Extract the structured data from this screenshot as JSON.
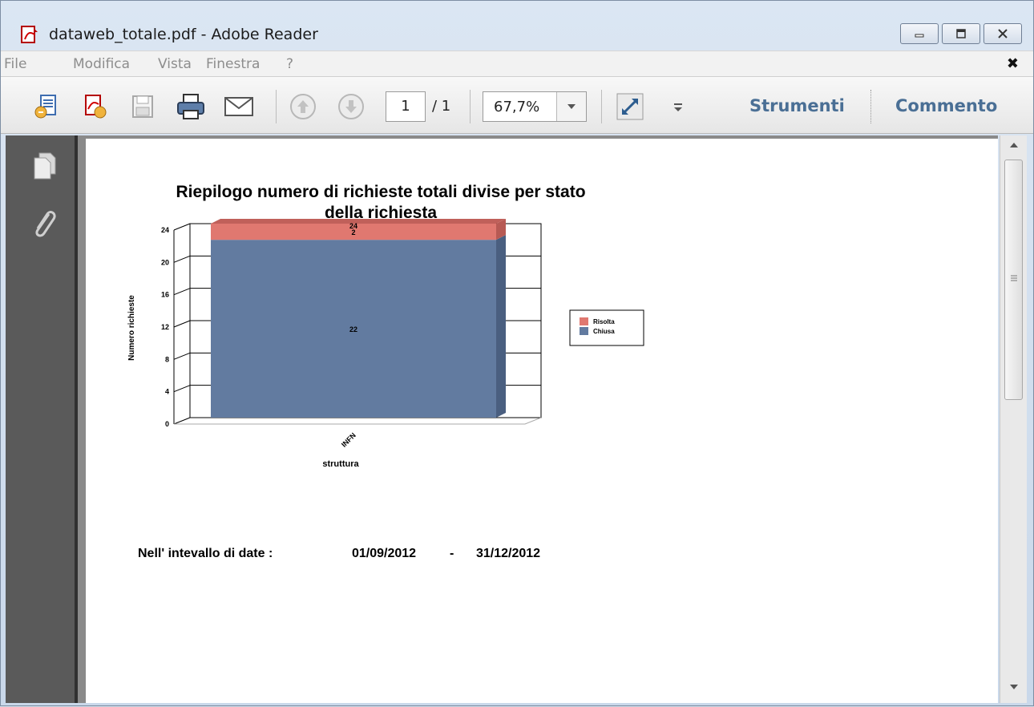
{
  "window": {
    "title": "dataweb_totale.pdf - Adobe Reader"
  },
  "menu": {
    "items": [
      "File",
      "Modifica",
      "Vista",
      "Finestra",
      "?"
    ],
    "close_symbol": "✖"
  },
  "toolbar": {
    "page_current": "1",
    "page_total": "/ 1",
    "zoom": "67,7%",
    "tools_label": "Strumenti",
    "comment_label": "Commento"
  },
  "document": {
    "date_range_label": "Nell' intevallo di date :",
    "date_from": "01/09/2012",
    "date_sep": "-",
    "date_to": "31/12/2012"
  },
  "chart_data": {
    "type": "bar",
    "stacked": true,
    "title": "Riepilogo numero di richieste totali divise per stato della richiesta",
    "title_lines": [
      "Riepilogo numero di richieste totali divise per stato",
      "della richiesta"
    ],
    "xlabel": "struttura",
    "ylabel": "Numero richieste",
    "categories": [
      "INFN"
    ],
    "series": [
      {
        "name": "Chiusa",
        "values": [
          22
        ],
        "color": "#627ba0"
      },
      {
        "name": "Risolta",
        "values": [
          2
        ],
        "color": "#e07870"
      }
    ],
    "total_labels": [
      "24"
    ],
    "ylim": [
      0,
      24
    ],
    "yticks": [
      "0",
      "4",
      "8",
      "12",
      "16",
      "20",
      "24"
    ],
    "legend_position": "right",
    "grid": true
  },
  "colors": {
    "accent_text": "#4a6f95",
    "panel_dark": "#5a5a5a"
  },
  "icons": [
    "pdf-file-icon",
    "create-pdf-icon",
    "pdf-settings-icon",
    "save-icon",
    "print-icon",
    "email-icon",
    "page-up-icon",
    "page-down-icon",
    "dropdown-arrow-icon",
    "fullscreen-icon",
    "more-icon",
    "pages-icon",
    "attachment-icon"
  ]
}
